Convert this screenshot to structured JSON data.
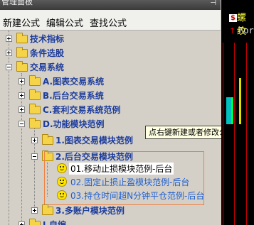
{
  "window": {
    "title": "管理面板",
    "pin_icon": "pin-icon"
  },
  "menu": {
    "items": [
      {
        "label": "新建公式"
      },
      {
        "label": "编辑公式"
      },
      {
        "label": "查找公式"
      }
    ]
  },
  "tree": {
    "nodes": [
      {
        "label": "技术指标"
      },
      {
        "label": "条件选股"
      },
      {
        "label": "交易系统"
      },
      {
        "label": "A.图表交易系统"
      },
      {
        "label": "B.后台交易系统"
      },
      {
        "label": "C.套利交易系统范例"
      },
      {
        "label": "D.功能模块范例"
      },
      {
        "label": "1.图表交易模块范例"
      },
      {
        "label": "2.后台交易模块范例"
      },
      {
        "label": "01.移动止损模块范例-后台"
      },
      {
        "label": "02.固定止损止盈模块范例-后台"
      },
      {
        "label": "03.持仓时间超N分钟平仓范例-后台"
      },
      {
        "label": "3.多账户模块范例"
      },
      {
        "label": "I.自编"
      }
    ]
  },
  "tooltip": {
    "text": "点右键新建或者修改公式"
  },
  "chart_strip": {
    "title": "螺纹",
    "subtitle": "For"
  },
  "colors": {
    "tree_label": "#1c3c9c",
    "highlight_ring": "#f08040",
    "tooltip_bg": "#ffffe1"
  }
}
